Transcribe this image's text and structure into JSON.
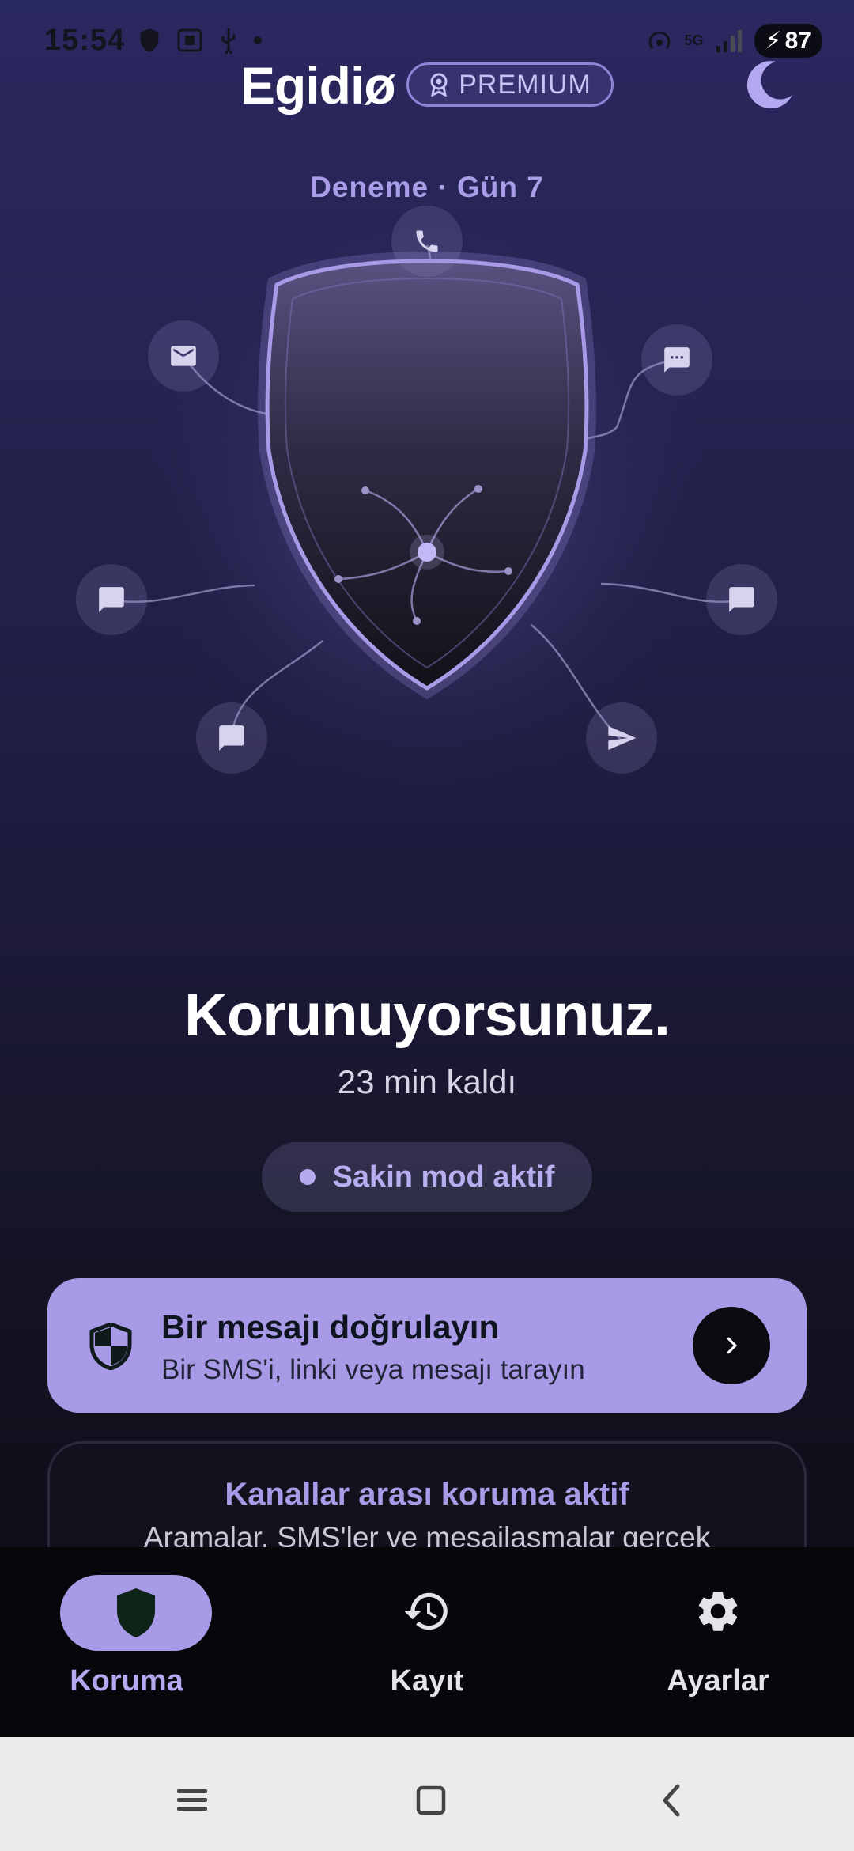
{
  "status_bar": {
    "time": "15:54",
    "network": "5G",
    "battery": "87"
  },
  "header": {
    "brand": "Egidiø",
    "premium_label": "PREMIUM"
  },
  "trial_label": "Deneme · Gün 7",
  "shield_nodes": [
    {
      "icon": "phone-icon"
    },
    {
      "icon": "mail-icon"
    },
    {
      "icon": "chat-dots-icon"
    },
    {
      "icon": "chat-icon"
    },
    {
      "icon": "chat-icon"
    },
    {
      "icon": "chat-icon"
    },
    {
      "icon": "send-icon"
    }
  ],
  "status": {
    "headline": "Korunuyorsunuz.",
    "remaining": "23 min kaldı",
    "calm_mode": "Sakin mod aktif"
  },
  "verify_card": {
    "title": "Bir mesajı doğrulayın",
    "subtitle": "Bir SMS'i, linki veya mesajı tarayın"
  },
  "cross_channel_card": {
    "title": "Kanallar arası koruma aktif",
    "body": "Aramalar, SMS'ler ve mesajlaşmalar gerçek"
  },
  "bottom_nav": {
    "items": [
      {
        "label": "Koruma",
        "icon": "shield-icon",
        "active": true
      },
      {
        "label": "Kayıt",
        "icon": "history-icon",
        "active": false
      },
      {
        "label": "Ayarlar",
        "icon": "gear-icon",
        "active": false
      }
    ]
  },
  "colors": {
    "accent": "#a99ae8",
    "background_top": "#2a2860",
    "background_bottom": "#0a0a12",
    "nav_background": "#06060b"
  }
}
